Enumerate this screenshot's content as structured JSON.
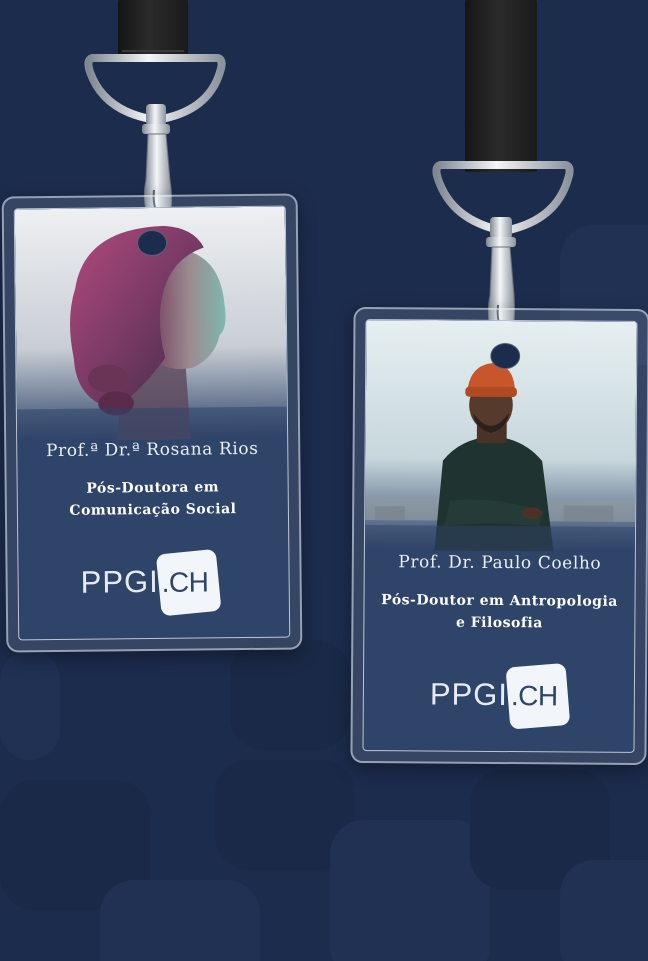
{
  "badges": [
    {
      "name": "Prof.ª Dr.ª Rosana Rios",
      "title_line1": "Pós-Doutora em",
      "title_line2": "Comunicação Social",
      "logo_left": "PPGI",
      "logo_right": ".CH"
    },
    {
      "name": "Prof. Dr. Paulo Coelho",
      "title_line1": "Pós-Doutor em Antropologia",
      "title_line2": "e Filosofia",
      "logo_left": "PPGI",
      "logo_right": ".CH"
    }
  ],
  "colors": {
    "background": "#1c2c4d",
    "card": "#2f4469",
    "text": "#ffffff"
  }
}
